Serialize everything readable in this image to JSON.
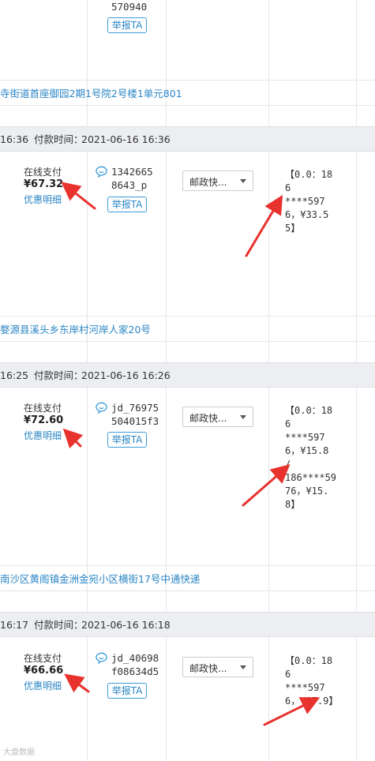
{
  "top": {
    "buyer_name_tail": "570940",
    "report_label": "举报TA",
    "address": "寺街道首座御园2期1号院2号楼1单元801"
  },
  "orders": [
    {
      "header_time_prefix": "16:36",
      "pay_time_label": "付款时间：",
      "pay_time": "2021-06-16 16:36",
      "pay_method": "在线支付",
      "amount": "¥67.32",
      "discount_label": "优惠明细",
      "buyer_line1": "1342665",
      "buyer_line2": "8643_p",
      "report_label": "举报TA",
      "shipping": "邮政快...",
      "note_lines": [
        "【0.0：186",
        "****597",
        "6，¥33.5",
        "5】"
      ],
      "address": "婺源县溪头乡东岸村河岸人家20号"
    },
    {
      "header_time_prefix": "16:25",
      "pay_time_label": "付款时间：",
      "pay_time": "2021-06-16 16:26",
      "pay_method": "在线支付",
      "amount": "¥72.60",
      "discount_label": "优惠明细",
      "buyer_line1": "jd_76975",
      "buyer_line2": "504015f3",
      "report_label": "举报TA",
      "shipping": "邮政快...",
      "note_lines": [
        "【0.0：186",
        "****597",
        "6，¥15.8 /",
        "186****59",
        "76，¥15.",
        "8】"
      ],
      "address": "南沙区黄阁镇金洲金宛小区横街17号中通快递"
    },
    {
      "header_time_prefix": "16:17",
      "pay_time_label": "付款时间：",
      "pay_time": "2021-06-16 16:18",
      "pay_method": "在线支付",
      "amount": "¥66.66",
      "discount_label": "优惠明细",
      "buyer_line1": "jd_40698",
      "buyer_line2": "f08634d5",
      "report_label": "举报TA",
      "shipping": "邮政快...",
      "note_lines": [
        "【0.0：186",
        "****597",
        "6，¥17.9】"
      ]
    }
  ],
  "watermark": "大盘数据",
  "colors": {
    "link": "#2b86c5",
    "header_bg": "#eceef1",
    "arrow": "#e8322e",
    "border": "#e4e6ea"
  }
}
